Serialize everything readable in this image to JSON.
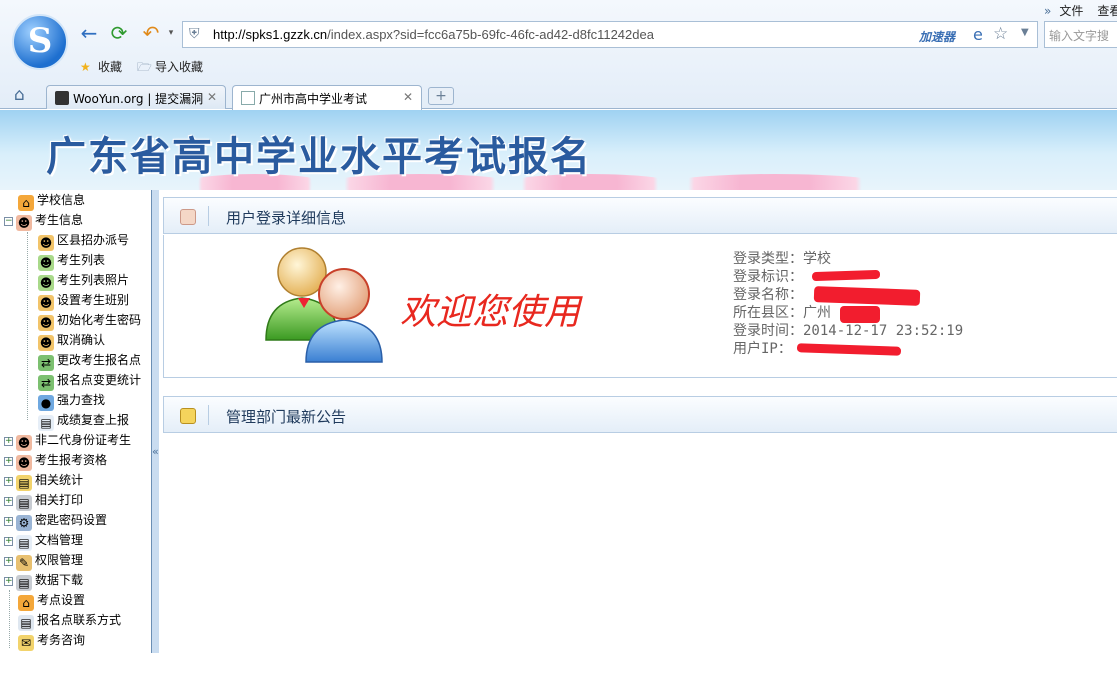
{
  "browser": {
    "top_menu": [
      "文件",
      "查看"
    ],
    "top_menu_chevron": "»",
    "address_url_host": "http://spks1.gzzk.cn",
    "address_url_rest": "/index.aspx?sid=fcc6a75b-69fc-46fc-ad42-d8fc11242dea",
    "accelerator_label": "加速器",
    "search_placeholder": "输入文字搜",
    "bookmarks": [
      {
        "label": "收藏",
        "icon": "star-icon"
      },
      {
        "label": "导入收藏",
        "icon": "folder-icon"
      }
    ],
    "tabs": [
      {
        "label": "WooYun.org | 提交漏洞",
        "active": false
      },
      {
        "label": "广州市高中学业考试",
        "active": true
      }
    ],
    "new_tab_label": "+"
  },
  "banner": {
    "title": "广东省高中学业水平考试报名"
  },
  "sidebar": {
    "items": [
      {
        "label": "学校信息",
        "level": 0,
        "expander": false,
        "icon": "home-icon"
      },
      {
        "label": "考生信息",
        "level": 0,
        "expander": "minus",
        "icon": "users-icon"
      },
      {
        "label": "区县招办派号",
        "level": 1,
        "icon": "users-assign-icon"
      },
      {
        "label": "考生列表",
        "level": 1,
        "icon": "user-list-icon"
      },
      {
        "label": "考生列表照片",
        "level": 1,
        "icon": "user-photo-icon"
      },
      {
        "label": "设置考生班别",
        "level": 1,
        "icon": "users-group-icon"
      },
      {
        "label": "初始化考生密码",
        "level": 1,
        "icon": "user-key-icon"
      },
      {
        "label": "取消确认",
        "level": 1,
        "icon": "user-cancel-icon"
      },
      {
        "label": "更改考生报名点",
        "level": 1,
        "icon": "transfer-icon"
      },
      {
        "label": "报名点变更统计",
        "level": 1,
        "icon": "transfer-stats-icon"
      },
      {
        "label": "强力查找",
        "level": 1,
        "icon": "search-globe-icon"
      },
      {
        "label": "成绩复查上报",
        "level": 1,
        "icon": "document-icon"
      },
      {
        "label": "非二代身份证考生",
        "level": 0,
        "expander": "plus",
        "icon": "users-icon"
      },
      {
        "label": "考生报考资格",
        "level": 0,
        "expander": "plus",
        "icon": "users-icon"
      },
      {
        "label": "相关统计",
        "level": 0,
        "expander": "plus",
        "icon": "stats-icon"
      },
      {
        "label": "相关打印",
        "level": 0,
        "expander": "plus",
        "icon": "printer-icon"
      },
      {
        "label": "密匙密码设置",
        "level": 0,
        "expander": "plus",
        "icon": "gear-icon"
      },
      {
        "label": "文档管理",
        "level": 0,
        "expander": "plus",
        "icon": "document-icon"
      },
      {
        "label": "权限管理",
        "level": 0,
        "expander": "plus",
        "icon": "permission-icon"
      },
      {
        "label": "数据下载",
        "level": 0,
        "expander": "plus",
        "icon": "download-icon"
      },
      {
        "label": "考点设置",
        "level": 0,
        "expander": false,
        "icon": "home-icon"
      },
      {
        "label": "报名点联系方式",
        "level": 0,
        "expander": false,
        "icon": "contact-icon"
      },
      {
        "label": "考务咨询",
        "level": 0,
        "expander": false,
        "icon": "chat-icon"
      }
    ],
    "collapse_arrow": "«"
  },
  "main": {
    "login_section_title": "用户登录详细信息",
    "welcome_text": "欢迎您使用",
    "login_info": [
      {
        "label": "登录类型：",
        "value": "学校"
      },
      {
        "label": "登录标识：",
        "value": ""
      },
      {
        "label": "登录名称：",
        "value": ""
      },
      {
        "label": "所在县区：",
        "value": "广州"
      },
      {
        "label": "登录时间：",
        "value": "2014-12-17 23:52:19"
      },
      {
        "label": "用户IP：",
        "value": ""
      }
    ],
    "notice_section_title": "管理部门最新公告"
  },
  "colors": {
    "accent": "#2a5b9f",
    "welcome": "#e8281f",
    "redaction": "#f21d2e"
  }
}
